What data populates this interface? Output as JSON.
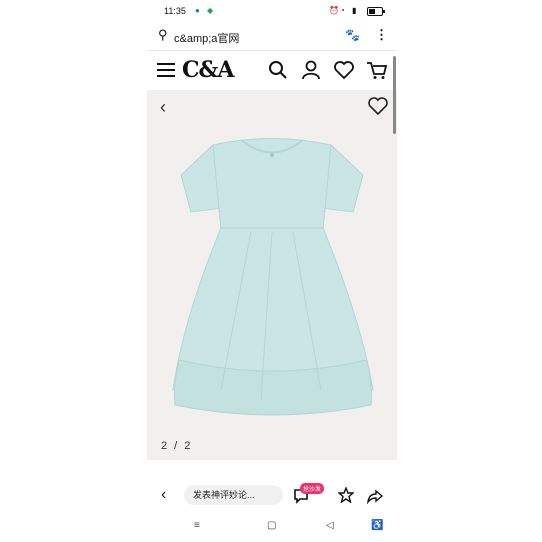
{
  "status_bar": {
    "time": "11:35"
  },
  "browser": {
    "url": "c&amp;a官网"
  },
  "site": {
    "logo": "C&A"
  },
  "gallery": {
    "counter": "2 / 2"
  },
  "bottom_bar": {
    "comment_placeholder": "发表神评妙论...",
    "badge": "抢沙发"
  },
  "colors": {
    "dress": "#c9e6e4",
    "dress_shadow": "#b3d6d4",
    "gallery_bg": "#f1f0ef",
    "badge": "#e8336d"
  }
}
